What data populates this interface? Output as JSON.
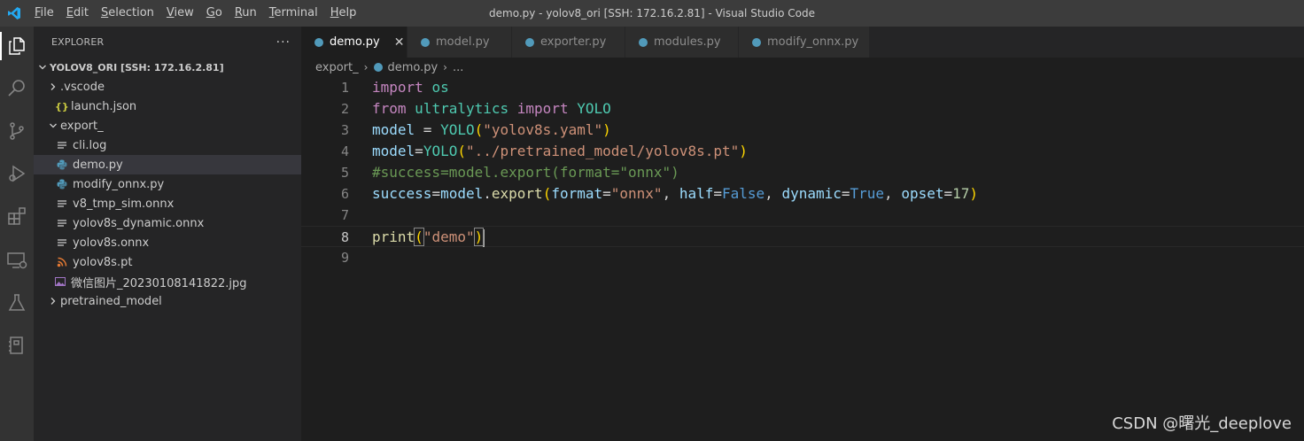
{
  "window": {
    "title": "demo.py - yolov8_ori [SSH: 172.16.2.81] - Visual Studio Code"
  },
  "menu": [
    {
      "ul": "F",
      "rest": "ile"
    },
    {
      "ul": "E",
      "rest": "dit"
    },
    {
      "ul": "S",
      "rest": "election"
    },
    {
      "ul": "V",
      "rest": "iew"
    },
    {
      "ul": "G",
      "rest": "o"
    },
    {
      "ul": "R",
      "rest": "un"
    },
    {
      "ul": "T",
      "rest": "erminal"
    },
    {
      "ul": "H",
      "rest": "elp"
    }
  ],
  "sidebar": {
    "title": "EXPLORER",
    "more": "···",
    "root": "YOLOV8_ORI [SSH: 172.16.2.81]",
    "items": [
      {
        "label": ".vscode",
        "icon": "chevron-right-icon"
      },
      {
        "label": "launch.json",
        "icon": "json-icon"
      },
      {
        "label": "export_",
        "icon": "chevron-down-icon"
      },
      {
        "label": "cli.log",
        "icon": "text-file-icon"
      },
      {
        "label": "demo.py",
        "icon": "python-icon"
      },
      {
        "label": "modify_onnx.py",
        "icon": "python-icon"
      },
      {
        "label": "v8_tmp_sim.onnx",
        "icon": "text-file-icon"
      },
      {
        "label": "yolov8s_dynamic.onnx",
        "icon": "text-file-icon"
      },
      {
        "label": "yolov8s.onnx",
        "icon": "text-file-icon"
      },
      {
        "label": "yolov8s.pt",
        "icon": "rss-icon"
      },
      {
        "label": "微信图片_20230108141822.jpg",
        "icon": "image-icon"
      },
      {
        "label": "pretrained_model",
        "icon": "chevron-right-icon"
      }
    ]
  },
  "tabs": [
    {
      "label": "demo.py",
      "close": "✕"
    },
    {
      "label": "model.py"
    },
    {
      "label": "exporter.py"
    },
    {
      "label": "modules.py"
    },
    {
      "label": "modify_onnx.py"
    }
  ],
  "breadcrumb": {
    "folder": "export_",
    "file": "demo.py",
    "more": "...",
    "sep": "›"
  },
  "code": {
    "line_numbers": [
      "1",
      "2",
      "3",
      "4",
      "5",
      "6",
      "7",
      "8",
      "9"
    ],
    "l1": {
      "kw": "import",
      "mod": "os"
    },
    "l2": {
      "kw1": "from",
      "mod": "ultralytics",
      "kw2": "import",
      "cls": "YOLO"
    },
    "l3": {
      "var": "model",
      "op": " = ",
      "cls": "YOLO",
      "open": "(",
      "str": "\"yolov8s.yaml\"",
      "close": ")"
    },
    "l4": {
      "var": "model",
      "op": "=",
      "cls": "YOLO",
      "open": "(",
      "str": "\"../pretrained_model/yolov8s.pt\"",
      "close": ")"
    },
    "l5": {
      "comment": "#success=model.export(format=\"onnx\")"
    },
    "l6": {
      "var1": "success",
      "eq1": "=",
      "var2": "model",
      "dot": ".",
      "fn": "export",
      "open": "(",
      "p1": "format",
      "eq2": "=",
      "s1": "\"onnx\"",
      "c1": ", ",
      "p2": "half",
      "eq3": "=",
      "b1": "False",
      "c2": ", ",
      "p3": "dynamic",
      "eq4": "=",
      "b2": "True",
      "c3": ", ",
      "p4": "opset",
      "eq5": "=",
      "n1": "17",
      "close": ")"
    },
    "l8": {
      "fn": "print",
      "open": "(",
      "str": "\"demo\"",
      "close": ")"
    }
  },
  "watermark": "CSDN @曙光_deeplove",
  "colors": {
    "accent": "#007acc",
    "keyword": "#c586c0",
    "string": "#ce9178",
    "comment": "#6a9955",
    "class": "#4ec9b0",
    "function": "#dcdcaa",
    "variable": "#9cdcfe"
  }
}
